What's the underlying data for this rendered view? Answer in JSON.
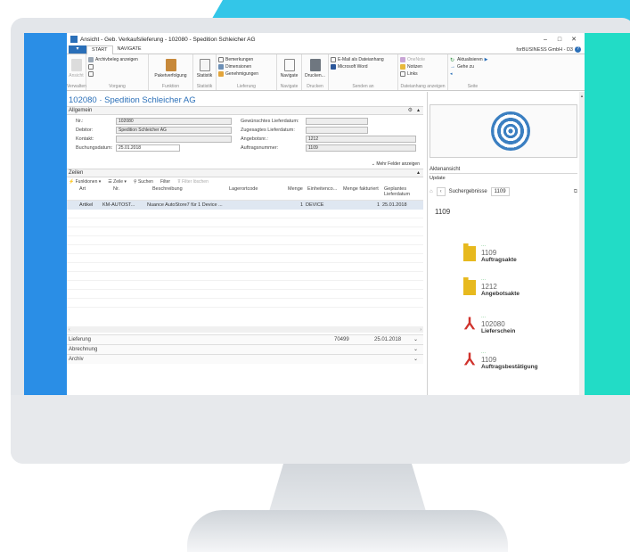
{
  "window": {
    "title": "Ansicht - Geb. Verkaufslieferung - 102080 - Spedition Schleicher AG",
    "company": "forBUSINESS GmbH - D3",
    "controls": [
      "–",
      "□",
      "✕"
    ]
  },
  "ribbon": {
    "tabs": [
      "START",
      "NAVIGATE"
    ],
    "groups": [
      {
        "label": "Verwalten",
        "buttons": [
          "Ansicht"
        ]
      },
      {
        "label": "Vorgang",
        "buttons": [
          "Archivbeleg anzeigen"
        ]
      },
      {
        "label": "Funktion",
        "buttons": [
          "Paketverfolgung"
        ]
      },
      {
        "label": "Statistik",
        "buttons": [
          "Statistik"
        ]
      },
      {
        "label": "Lieferung",
        "buttons": [
          "Bemerkungen",
          "Dimensionen",
          "Genehmigungen"
        ]
      },
      {
        "label": "Navigate",
        "buttons": [
          "Navigate"
        ]
      },
      {
        "label": "Drucken",
        "buttons": [
          "Drucken..."
        ]
      },
      {
        "label": "Senden an",
        "buttons": [
          "E-Mail als Dateianhang",
          "Microsoft Word"
        ]
      },
      {
        "label": "Dateianhang anzeigen",
        "buttons": [
          "OneNote",
          "Notizen",
          "Links"
        ]
      },
      {
        "label": "Seite",
        "buttons": [
          "Aktualisieren",
          "Gehe zu"
        ]
      }
    ]
  },
  "page": {
    "title": "102080 · Spedition Schleicher AG"
  },
  "allgemein": {
    "header": "Allgemein",
    "nr_label": "Nr.:",
    "nr": "102080",
    "debitor_label": "Debitor:",
    "debitor": "Spedition Schleicher AG",
    "kontakt_label": "Kontakt:",
    "kontakt": "",
    "buchungsdatum_label": "Buchungsdatum:",
    "buchungsdatum": "25.01.2018",
    "gew_label": "Gewünschtes Lieferdatum:",
    "gew": "",
    "zug_label": "Zugesagtes Lieferdatum:",
    "zug": "",
    "angebot_label": "Angebotsnr.:",
    "angebot": "1212",
    "auftrag_label": "Auftragsnummer:",
    "auftrag": "1109",
    "more": "Mehr Felder anzeigen"
  },
  "zeilen": {
    "header": "Zeilen",
    "toolbar": [
      "Funktionen",
      "Zeile",
      "Suchen",
      "Filter",
      "Filter löschen"
    ],
    "columns": [
      "Art",
      "Nr.",
      "Beschreibung",
      "Lagerortcode",
      "Menge",
      "Einheitenco...",
      "Menge fakturiert",
      "Geplantes Lieferdatum"
    ],
    "row": {
      "art": "Artikel",
      "nr": "KM-AUTOST...",
      "beschreibung": "Nuance AutoStore7 für 1 Device ...",
      "lagerort": "",
      "menge": "1",
      "einheit": "DEVICE",
      "fakturiert": "1",
      "datum": "25.01.2018"
    }
  },
  "footer": {
    "lieferung": "Lieferung",
    "lieferung_val1": "70499",
    "lieferung_val2": "25.01.2018",
    "abrechnung": "Abrechnung",
    "archiv": "Archiv"
  },
  "side": {
    "aktenansicht": "Aktenansicht",
    "update": "Update",
    "crumb1": "Suchergebnisse",
    "crumb2": "1109",
    "number": "1109",
    "docs": [
      {
        "num": "1109",
        "name": "Auftragsakte",
        "icon": "folder-icon"
      },
      {
        "num": "1212",
        "name": "Angebotsakte",
        "icon": "folder-icon"
      },
      {
        "num": "102080",
        "name": "Lieferschein",
        "icon": "pdf-icon"
      },
      {
        "num": "1109",
        "name": "Auftragsbestätigung",
        "icon": "pdf-icon"
      }
    ]
  },
  "colors": {
    "accent": "#2a6fb8",
    "blue_panel": "#2a8ee6",
    "teal_panel": "#22dcc6",
    "row_highlight": "#dfe7f1"
  }
}
